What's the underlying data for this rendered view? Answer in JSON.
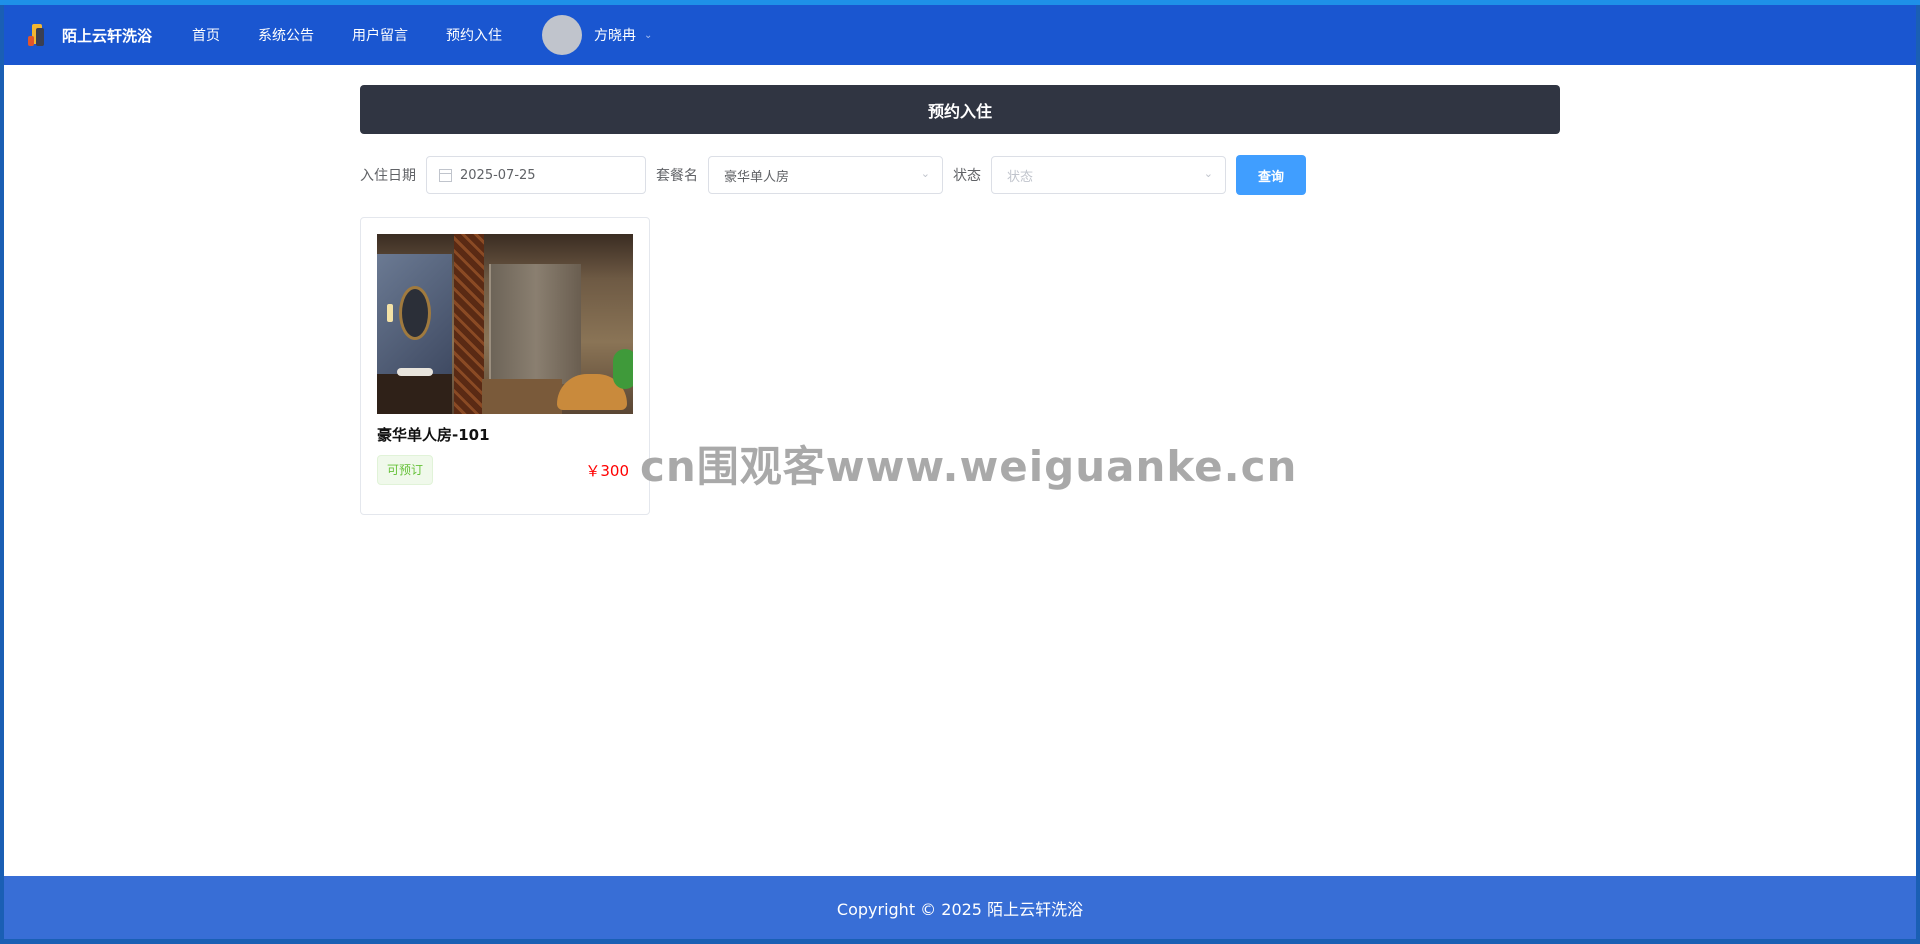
{
  "header": {
    "brand_name": "陌上云轩洗浴",
    "nav": [
      "首页",
      "系统公告",
      "用户留言",
      "预约入住"
    ],
    "user_name": "方晓冉"
  },
  "page": {
    "title": "预约入住"
  },
  "filters": {
    "date_label": "入住日期",
    "date_value": "2025-07-25",
    "package_label": "套餐名",
    "package_value": "豪华单人房",
    "status_label": "状态",
    "status_placeholder": "状态",
    "query_label": "查询"
  },
  "rooms": [
    {
      "name": "豪华单人房-101",
      "status": "可预订",
      "price": "￥300"
    }
  ],
  "watermark": "cn围观客www.weiguanke.cn",
  "footer": {
    "copyright": "Copyright © 2025 陌上云轩洗浴"
  },
  "colors": {
    "header_bg": "#1a56d0",
    "title_bar_bg": "#303542",
    "primary_button": "#409eff",
    "status_green": "#67c23a",
    "price_red": "#ff0000",
    "footer_bg": "#386ed6"
  },
  "icons": {
    "logo": "brand-logo-icon",
    "date": "calendar-icon",
    "select_arrow": "chevron-down-icon",
    "user_caret": "chevron-down-icon"
  }
}
